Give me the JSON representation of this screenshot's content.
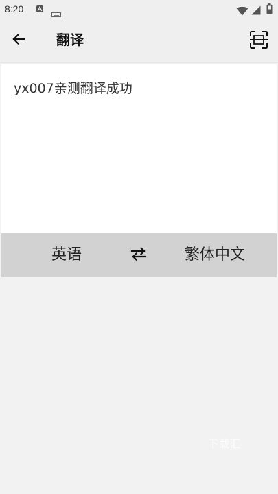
{
  "status_bar": {
    "time": "8:20",
    "icons": [
      "a-notification-icon",
      "keyboard-icon",
      "wifi-icon",
      "signal-icon",
      "battery-icon"
    ]
  },
  "app_bar": {
    "title": "翻译",
    "back_icon": "arrow-left-icon",
    "scan_icon": "scan-icon"
  },
  "translation": {
    "source_text": "yx007亲测翻译成功"
  },
  "languages": {
    "source": "英语",
    "target": "繁体中文",
    "swap_icon": "swap-arrows-icon"
  },
  "watermark": {
    "text": "下载汇"
  },
  "colors": {
    "background": "#f2f2f2",
    "app_bar": "#efefef",
    "card": "#ffffff",
    "language_bar": "#d2d2d2",
    "text": "#222222"
  }
}
